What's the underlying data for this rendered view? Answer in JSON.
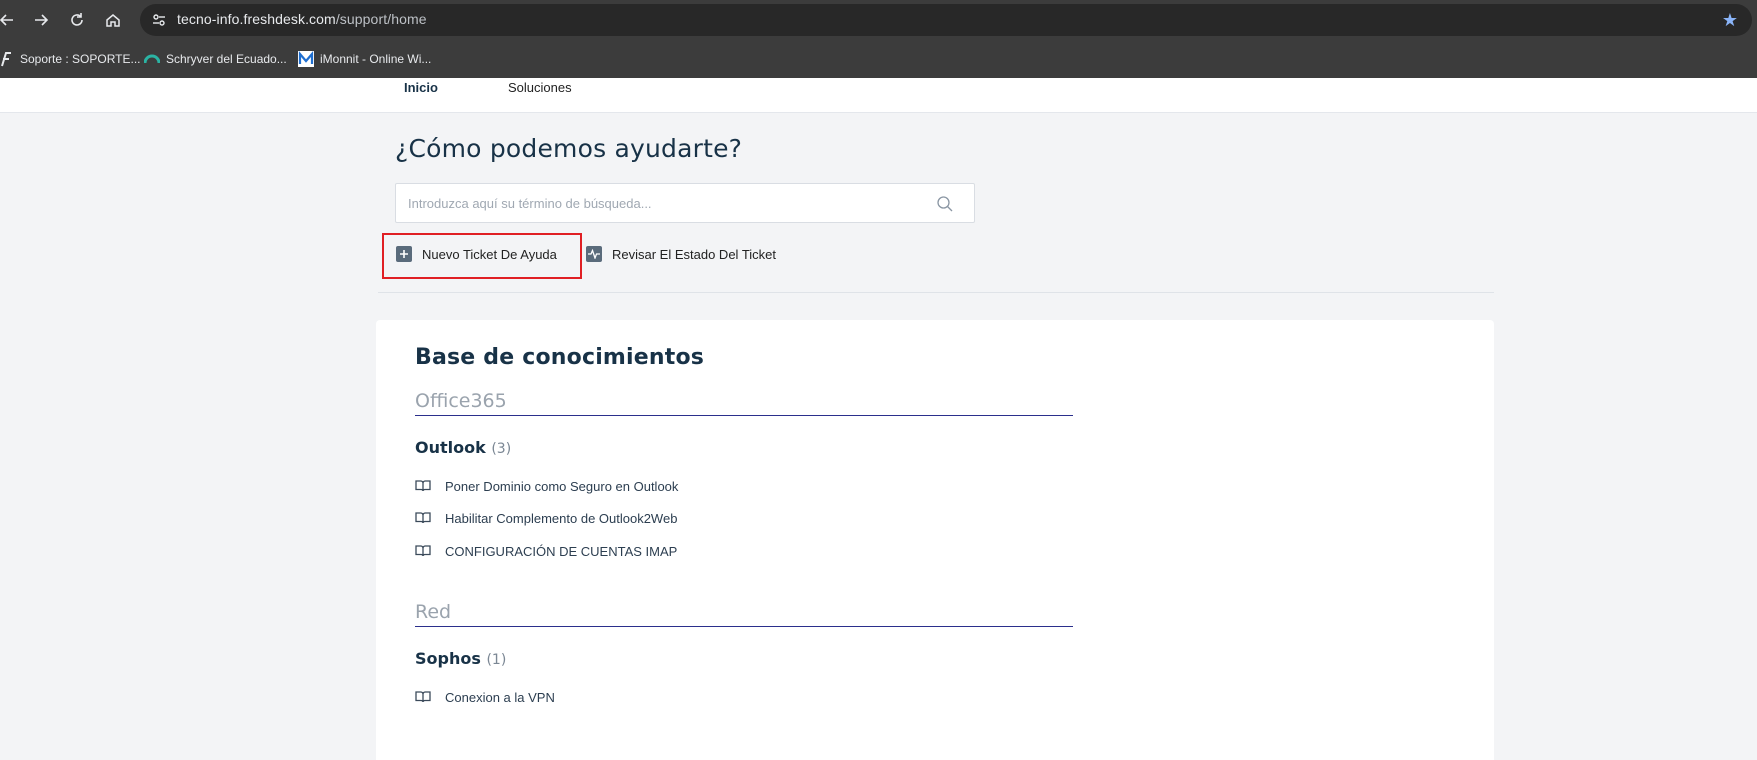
{
  "browser": {
    "url_domain": "tecno-info.freshdesk.com",
    "url_path": "/support/home",
    "bookmarks": [
      {
        "label": "Soporte : SOPORTE...",
        "icon": "freshdesk-icon"
      },
      {
        "label": "Schryver del Ecuado...",
        "icon": "schryver-icon"
      },
      {
        "label": "iMonnit - Online Wi...",
        "icon": "imonnit-icon"
      }
    ]
  },
  "nav": {
    "tabs": [
      {
        "label": "Inicio",
        "active": true
      },
      {
        "label": "Soluciones",
        "active": false
      }
    ]
  },
  "hero": {
    "title": "¿Cómo podemos ayudarte?",
    "search_placeholder": "Introduzca aquí su término de búsqueda..."
  },
  "actions": {
    "new_ticket": "Nuevo Ticket De Ayuda",
    "check_status": "Revisar El Estado Del Ticket"
  },
  "kb": {
    "title": "Base de conocimientos",
    "categories": [
      {
        "name": "Office365",
        "folders": [
          {
            "name": "Outlook",
            "count": "(3)",
            "articles": [
              "Poner Dominio como Seguro en Outlook",
              "Habilitar Complemento de Outlook2Web",
              "CONFIGURACIÓN DE CUENTAS IMAP"
            ]
          }
        ]
      },
      {
        "name": "Red",
        "folders": [
          {
            "name": "Sophos",
            "count": "(1)",
            "articles": [
              "Conexion a la VPN"
            ]
          }
        ]
      }
    ]
  },
  "colors": {
    "highlight": "#e01f24",
    "category_rule": "#2b2f8c",
    "heading": "#183247"
  }
}
